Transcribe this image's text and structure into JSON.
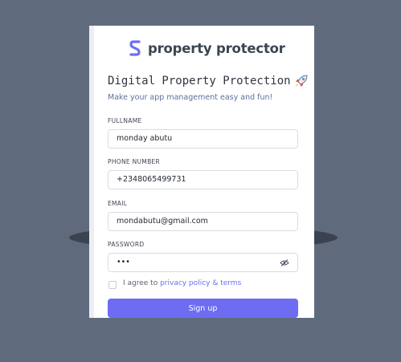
{
  "brand": {
    "name": "property protector",
    "logo_icon": "s-shape-logo",
    "logo_color": "#6b6ff2"
  },
  "heading": {
    "title": "Digital Property Protection",
    "emoji": "rocket-icon"
  },
  "subheading": "Make your app management easy and fun!",
  "form": {
    "fullname": {
      "label": "FULLNAME",
      "value": "monday abutu"
    },
    "phone": {
      "label": "PHONE NUMBER",
      "value": "+2348065499731"
    },
    "email": {
      "label": "EMAIL",
      "value": "mondabutu@gmail.com"
    },
    "password": {
      "label": "PASSWORD",
      "value": "•••",
      "toggle_icon": "eye-off-icon"
    },
    "agree": {
      "prefix": "I agree to ",
      "link": "privacy policy & terms",
      "checked": false
    },
    "submit_label": "Sign up"
  },
  "colors": {
    "accent": "#6e6cf2",
    "backdrop": "#5f6b7d",
    "card": "#ffffff"
  }
}
